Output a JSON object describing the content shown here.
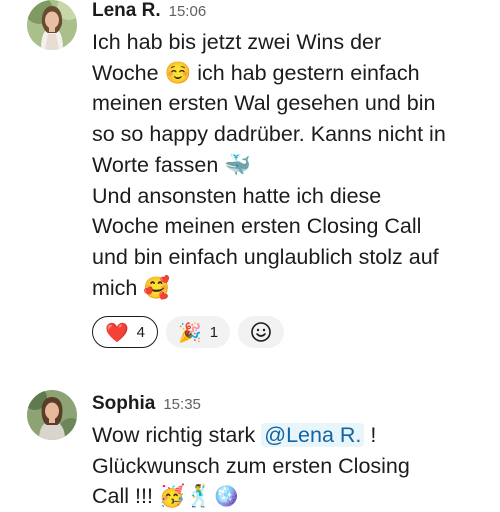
{
  "messages": [
    {
      "author": "Lena R.",
      "time": "15:06",
      "lines": [
        "Ich hab bis jetzt zwei Wins der",
        "Woche ☺️ ich hab gestern einfach",
        "meinen ersten Wal gesehen und bin",
        "so so happy dadrüber. Kanns nicht in",
        "Worte fassen 🐳",
        "Und ansonsten hatte ich diese",
        "Woche meinen ersten Closing Call",
        "und bin einfach unglaublich stolz auf",
        "mich 🥰"
      ],
      "reactions": [
        {
          "emoji": "❤️",
          "count": "4",
          "icon": "red-heart-icon",
          "selected": true
        },
        {
          "emoji": "🎉",
          "count": "1",
          "icon": "party-popper-icon",
          "selected": false
        }
      ],
      "add_reaction_icon": "smiley-add-reaction-icon"
    },
    {
      "author": "Sophia",
      "time": "15:35",
      "line1_before": "Wow richtig stark",
      "mention": "@Lena R.",
      "line1_after": "!",
      "line2": "Glückwunsch zum ersten Closing",
      "line3": "Call !!! 🥳🕺🪩"
    }
  ],
  "colors": {
    "mention_text": "#1264a3",
    "mention_bg": "#e8f5fa",
    "timestamp": "#616061",
    "reaction_bg": "#f2f2f2"
  }
}
